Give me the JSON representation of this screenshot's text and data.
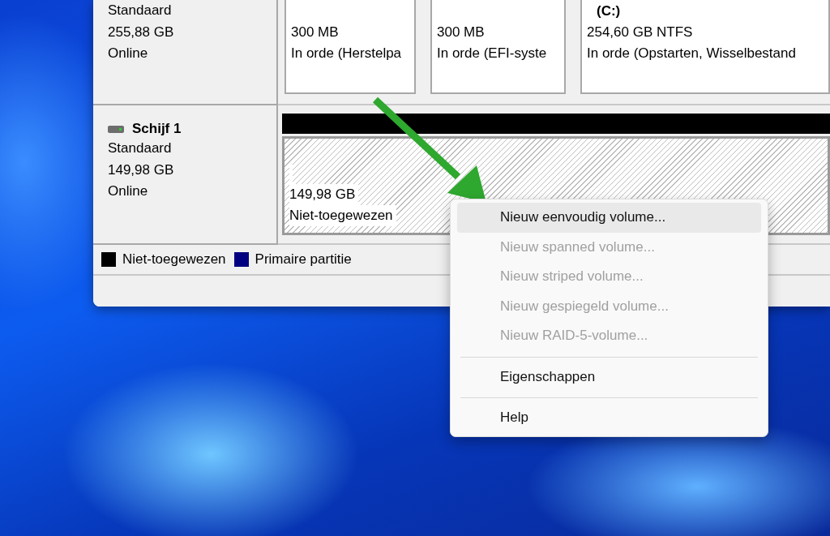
{
  "disks": [
    {
      "type": "Standaard",
      "size": "255,88 GB",
      "status": "Online",
      "partitions": [
        {
          "kind": "primary",
          "size": "300 MB",
          "status": "In orde (Herstelpa"
        },
        {
          "kind": "primary",
          "size": "300 MB",
          "status": "In orde (EFI-syste"
        },
        {
          "kind": "primary",
          "label": "(C:)",
          "size": "254,60 GB NTFS",
          "status": "In orde (Opstarten, Wisselbestand"
        }
      ]
    },
    {
      "name": "Schijf 1",
      "type": "Standaard",
      "size": "149,98 GB",
      "status": "Online",
      "partitions": [
        {
          "kind": "unallocated",
          "size": "149,98 GB",
          "status": "Niet-toegewezen"
        }
      ]
    }
  ],
  "legend": [
    {
      "label": "Niet-toegewezen",
      "color": "#000000"
    },
    {
      "label": "Primaire partitie",
      "color": "#000080"
    }
  ],
  "context_menu": [
    {
      "kind": "item",
      "label": "Nieuw eenvoudig volume...",
      "disabled": false,
      "highlighted": true
    },
    {
      "kind": "item",
      "label": "Nieuw spanned volume...",
      "disabled": true,
      "highlighted": false
    },
    {
      "kind": "item",
      "label": "Nieuw striped volume...",
      "disabled": true,
      "highlighted": false
    },
    {
      "kind": "item",
      "label": "Nieuw gespiegeld volume...",
      "disabled": true,
      "highlighted": false
    },
    {
      "kind": "item",
      "label": "Nieuw RAID-5-volume...",
      "disabled": true,
      "highlighted": false
    },
    {
      "kind": "separator"
    },
    {
      "kind": "item",
      "label": "Eigenschappen",
      "disabled": false,
      "highlighted": false
    },
    {
      "kind": "separator"
    },
    {
      "kind": "item",
      "label": "Help",
      "disabled": false,
      "highlighted": false
    }
  ]
}
